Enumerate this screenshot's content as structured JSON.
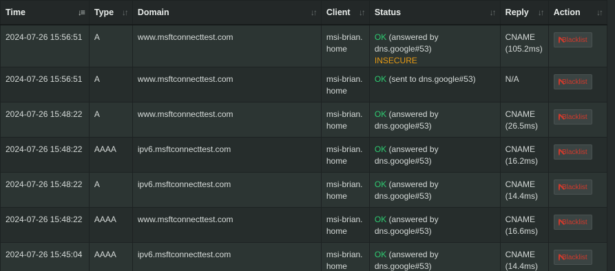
{
  "columns": {
    "time": "Time",
    "type": "Type",
    "domain": "Domain",
    "client": "Client",
    "status": "Status",
    "reply": "Reply",
    "action": "Action"
  },
  "icons": {
    "sort_active": "sort-descending-icon",
    "sort": "sort-icon",
    "blacklist": "ban-icon"
  },
  "colors": {
    "ok": "#2ecc71",
    "insecure": "#e69a14",
    "blacklist": "#d33a2c"
  },
  "rows": [
    {
      "time": "2024-07-26 15:56:51",
      "type": "A",
      "domain": "www.msftconnecttest.com",
      "client_line1": "msi-brian.",
      "client_line2": "home",
      "status_ok": "OK",
      "status_detail": " (answered by dns.google#53)",
      "status_extra": "INSECURE",
      "reply_line1": "CNAME",
      "reply_line2": "(105.2ms)",
      "action": "Blacklist"
    },
    {
      "time": "2024-07-26 15:56:51",
      "type": "A",
      "domain": "www.msftconnecttest.com",
      "client_line1": "msi-brian.",
      "client_line2": "home",
      "status_ok": "OK",
      "status_detail": " (sent to dns.google#53)",
      "status_extra": "",
      "reply_line1": "N/A",
      "reply_line2": "",
      "action": "Blacklist"
    },
    {
      "time": "2024-07-26 15:48:22",
      "type": "A",
      "domain": "www.msftconnecttest.com",
      "client_line1": "msi-brian.",
      "client_line2": "home",
      "status_ok": "OK",
      "status_detail": " (answered by dns.google#53)",
      "status_extra": "",
      "reply_line1": "CNAME",
      "reply_line2": "(26.5ms)",
      "action": "Blacklist"
    },
    {
      "time": "2024-07-26 15:48:22",
      "type": "AAAA",
      "domain": "ipv6.msftconnecttest.com",
      "client_line1": "msi-brian.",
      "client_line2": "home",
      "status_ok": "OK",
      "status_detail": " (answered by dns.google#53)",
      "status_extra": "",
      "reply_line1": "CNAME",
      "reply_line2": "(16.2ms)",
      "action": "Blacklist"
    },
    {
      "time": "2024-07-26 15:48:22",
      "type": "A",
      "domain": "ipv6.msftconnecttest.com",
      "client_line1": "msi-brian.",
      "client_line2": "home",
      "status_ok": "OK",
      "status_detail": " (answered by dns.google#53)",
      "status_extra": "",
      "reply_line1": "CNAME",
      "reply_line2": "(14.4ms)",
      "action": "Blacklist"
    },
    {
      "time": "2024-07-26 15:48:22",
      "type": "AAAA",
      "domain": "www.msftconnecttest.com",
      "client_line1": "msi-brian.",
      "client_line2": "home",
      "status_ok": "OK",
      "status_detail": " (answered by dns.google#53)",
      "status_extra": "",
      "reply_line1": "CNAME",
      "reply_line2": "(16.6ms)",
      "action": "Blacklist"
    },
    {
      "time": "2024-07-26 15:45:04",
      "type": "AAAA",
      "domain": "ipv6.msftconnecttest.com",
      "client_line1": "msi-brian.",
      "client_line2": "home",
      "status_ok": "OK",
      "status_detail": " (answered by dns.google#53)",
      "status_extra": "",
      "reply_line1": "CNAME",
      "reply_line2": "(14.4ms)",
      "action": "Blacklist"
    }
  ]
}
